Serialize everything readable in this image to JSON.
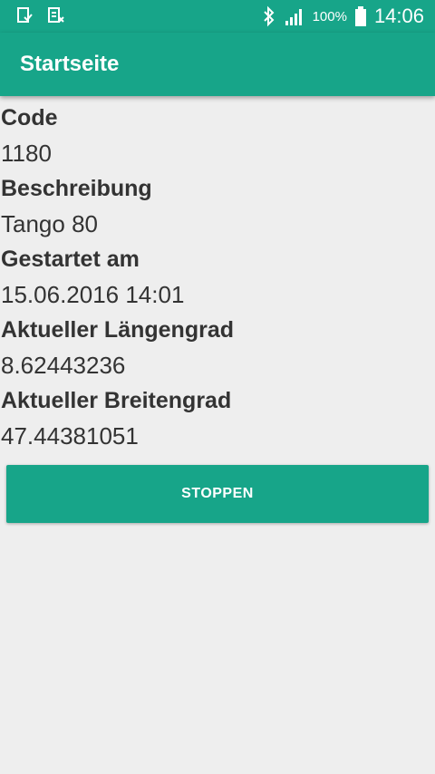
{
  "status_bar": {
    "battery_percent": "100%",
    "time": "14:06",
    "icons": [
      "sync-icon",
      "sim-icon",
      "bluetooth-icon",
      "signal-icon",
      "battery-icon"
    ]
  },
  "app_bar": {
    "title": "Startseite"
  },
  "fields": [
    {
      "label": "Code",
      "value": "1180"
    },
    {
      "label": "Beschreibung",
      "value": "Tango 80"
    },
    {
      "label": "Gestartet am",
      "value": "15.06.2016 14:01"
    },
    {
      "label": "Aktueller Längengrad",
      "value": "8.62443236"
    },
    {
      "label": "Aktueller Breitengrad",
      "value": "47.44381051"
    }
  ],
  "stop_button": {
    "label": "STOPPEN"
  },
  "colors": {
    "primary": "#17a589",
    "background": "#eeeeee",
    "text": "#333333"
  }
}
